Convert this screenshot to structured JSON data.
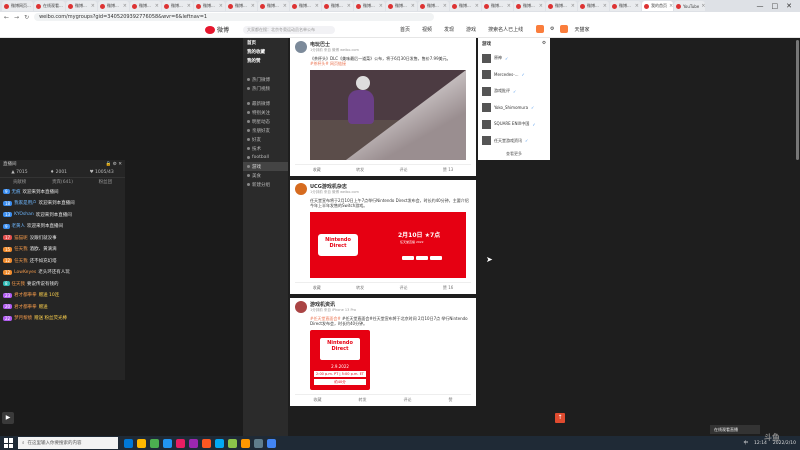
{
  "browser": {
    "tabs": [
      {
        "label": "微博网页..."
      },
      {
        "label": "在线观看..."
      },
      {
        "label": "微博..."
      },
      {
        "label": "微博..."
      },
      {
        "label": "微博..."
      },
      {
        "label": "微博..."
      },
      {
        "label": "微博..."
      },
      {
        "label": "微博..."
      },
      {
        "label": "微博..."
      },
      {
        "label": "微博..."
      },
      {
        "label": "微博..."
      },
      {
        "label": "微博..."
      },
      {
        "label": "微博..."
      },
      {
        "label": "微博..."
      },
      {
        "label": "微博..."
      },
      {
        "label": "微博..."
      },
      {
        "label": "微博..."
      },
      {
        "label": "微博..."
      },
      {
        "label": "微博..."
      },
      {
        "label": "微博..."
      },
      {
        "label": "我的首页"
      },
      {
        "label": "YouTube"
      }
    ],
    "url": "weibo.com/mygroups?gid=3405209392776058&wvr=6&leftnav=1",
    "window_controls": [
      "—",
      "□",
      "✕"
    ]
  },
  "weibo_header": {
    "logo_text": "微博",
    "search_placeholder": "大家都在搜：北京冬奥运动员名单公布",
    "nav": [
      {
        "label": "首页"
      },
      {
        "label": "视频"
      },
      {
        "label": "发现"
      },
      {
        "label": "游戏"
      },
      {
        "label": "搜索名人已上线"
      }
    ],
    "user_name": "天猫家"
  },
  "chat": {
    "header_title": "直播间",
    "stats": {
      "viewers": "7015",
      "fans": "2001",
      "popularity": "1005/43"
    },
    "categories": [
      "贡献榜",
      "贵宾(641)",
      "粉丝团"
    ],
    "messages": [
      {
        "lvl": "9",
        "lc": "b",
        "name": "无痕",
        "text": "欢迎来到本直播间"
      },
      {
        "lvl": "18",
        "lc": "b",
        "name": "我家是用户",
        "text": "欢迎来到本直播间"
      },
      {
        "lvl": "13",
        "lc": "b",
        "name": "KYOshan",
        "text": "欢迎来到本直播间"
      },
      {
        "lvl": "9",
        "lc": "b",
        "name": "老黄人",
        "text": "欢迎来到本直播间"
      },
      {
        "lvl": "17",
        "lc": "r",
        "name": "猫猫呢",
        "text": "没跟们就没事"
      },
      {
        "lvl": "15",
        "lc": "o",
        "name": "任天我",
        "text": "酒欧、黄滴滴"
      },
      {
        "lvl": "12",
        "lc": "o",
        "name": "任天我",
        "text": "还不如充幻塔"
      },
      {
        "lvl": "12",
        "lc": "o",
        "name": "LowKeyes",
        "text": "老头环还有人玩"
      },
      {
        "lvl": "8",
        "lc": "t",
        "name": "任天我",
        "text": "要说传说有钱的"
      },
      {
        "lvl": "23",
        "lc": "p",
        "name": "君才都拳拳",
        "text": "赠送 10连"
      },
      {
        "lvl": "20",
        "lc": "p",
        "name": "君才都拳拳",
        "text": "赠送"
      },
      {
        "lvl": "22",
        "lc": "p",
        "name": "梦月黎绩",
        "text": "赠送 粉丝荧光棒"
      }
    ]
  },
  "weibo_sidebar": {
    "items": [
      {
        "label": "首页",
        "kind": "group"
      },
      {
        "label": "我的收藏",
        "kind": "group"
      },
      {
        "label": "我的赞",
        "kind": "group"
      },
      {
        "label": "热门微博",
        "kind": "sub"
      },
      {
        "label": "热门视频",
        "kind": "sub"
      },
      {
        "label": "最新微博",
        "kind": "sub"
      },
      {
        "label": "特别关注",
        "kind": "sub"
      },
      {
        "label": "明星动态",
        "kind": "sub"
      },
      {
        "label": "亲朋好友",
        "kind": "sub"
      },
      {
        "label": "好友",
        "kind": "sub"
      },
      {
        "label": "技术",
        "kind": "sub"
      },
      {
        "label": "football",
        "kind": "sub"
      },
      {
        "label": "游戏",
        "kind": "hi"
      },
      {
        "label": "美食",
        "kind": "sub"
      },
      {
        "label": "新建分组",
        "kind": "sub"
      }
    ]
  },
  "feed": {
    "posts": [
      {
        "name": "电玩巴士",
        "meta": "1分钟前 来自 微博 weibo.com",
        "body": "《茶杯头》DLC《美味最后一道菜》公布，将于6月30日发售，售价7.99美元。",
        "link": "#茶杯头# 网页链接",
        "actions": [
          "收藏",
          "转发",
          "评论",
          "赞 13"
        ]
      },
      {
        "name": "UCG游戏机杂志",
        "meta": "1分钟前 来自 微博 weibo.com",
        "body": "任天堂宣布将于2月10日上午7点举行Nintendo Direct发布会，时长约40分钟，主要介绍今年上半年发售的Switch游戏。",
        "link": "",
        "actions": [
          "收藏",
          "转发",
          "评论",
          "赞 16"
        ],
        "image": {
          "title": "Nintendo Direct",
          "date": "2月10日 ★7点",
          "subtitle": "任天堂直播 2022"
        }
      },
      {
        "name": "游戏机资讯",
        "meta": "1分钟前 来自 iPhone 13 Pro",
        "body": "#任天堂直面会#任天堂宣布将于北京时间 2月10日7点 举行Nintendo Direct发布会，时长约40分钟。",
        "link": "#任天堂直面会#",
        "actions": [
          "收藏",
          "转发",
          "评论",
          "赞"
        ],
        "image": {
          "title": "Nintendo Direct",
          "date": "2.9.2022",
          "time1": "2:00 p.m. PT | 5:00 p.m. ET",
          "time2": "約40分"
        }
      }
    ]
  },
  "right_panel": {
    "title": "游戏",
    "items": [
      {
        "name": "原神"
      },
      {
        "name": "Mercedes-..."
      },
      {
        "name": "游戏批评"
      },
      {
        "name": "Yoko_Shimomura"
      },
      {
        "name": "SQUARE ENIX中国"
      },
      {
        "name": "任天堂游戏资讯"
      }
    ],
    "more_label": "查看更多"
  },
  "taskbar": {
    "search_placeholder": "在这里输入你要搜索的内容",
    "tray_time": "12:14",
    "tray_date": "2022/2/10",
    "lang": "中"
  },
  "notification": "在线观看直播",
  "corner_logo": "斗鱼",
  "colors": {
    "accent": "#e6162d",
    "orange": "#eb7350",
    "dark_bg": "#1e1e1e"
  }
}
